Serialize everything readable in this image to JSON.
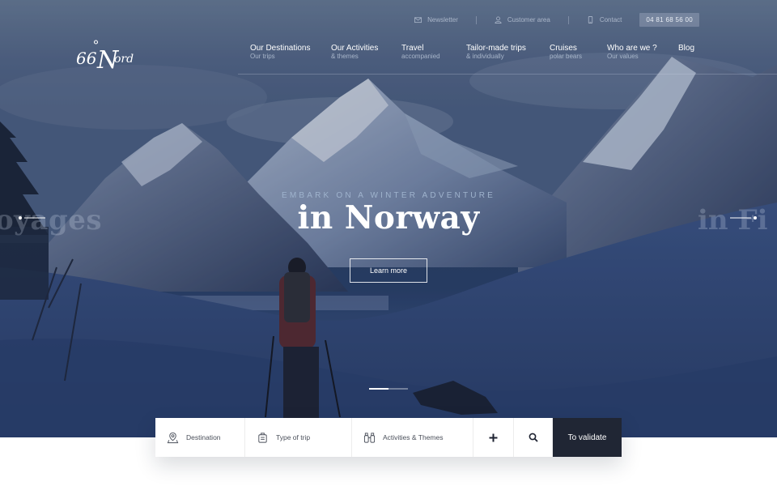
{
  "header": {
    "logo_text": "66°Nord",
    "top_links": [
      {
        "label": "Newsletter",
        "icon": "mail-icon"
      },
      {
        "label": "Customer area",
        "icon": "user-icon"
      },
      {
        "label": "Contact",
        "icon": "phone-icon"
      }
    ],
    "phone": "04 81 68 56 00"
  },
  "nav": {
    "items": [
      {
        "title": "Our Destinations",
        "sub": "Our trips"
      },
      {
        "title": "Our Activities",
        "sub": "& themes"
      },
      {
        "title": "Travel",
        "sub": "accompanied"
      },
      {
        "title": "Tailor-made trips",
        "sub": "& individually"
      },
      {
        "title": "Cruises",
        "sub": "polar bears"
      },
      {
        "title": "Who are we ?",
        "sub": "Our values"
      },
      {
        "title": "Blog",
        "sub": ""
      }
    ]
  },
  "hero": {
    "kicker": "EMBARK ON A WINTER ADVENTURE",
    "headline": "in Norway",
    "prev_slide_ghost": "oyages",
    "next_slide_ghost": "in Fi",
    "cta": "Learn more",
    "slider_position": 0.5
  },
  "search": {
    "destination": "Destination",
    "trip_type": "Type of trip",
    "activities": "Activities & Themes",
    "plus_icon": "plus-icon",
    "search_icon": "search-icon",
    "submit": "To validate"
  },
  "colors": {
    "accent_dark": "#202634",
    "hero_blue": "#2c4265"
  }
}
